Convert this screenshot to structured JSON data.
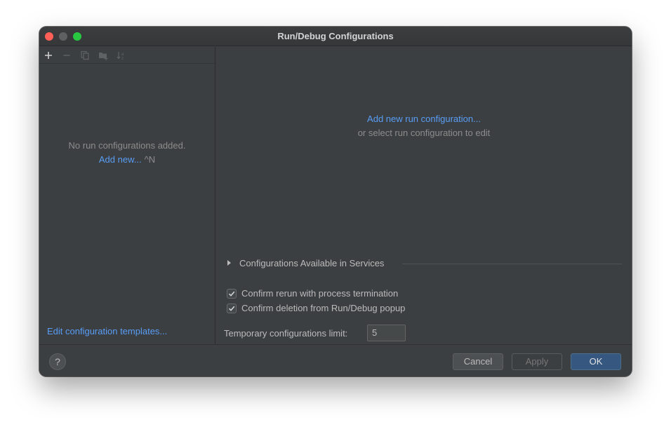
{
  "window": {
    "title": "Run/Debug Configurations",
    "traffic_colors": {
      "close": "#ff5f57",
      "minimize": "#5e6062",
      "maximize": "#28c840"
    }
  },
  "toolbar": {
    "icons": [
      "add-icon",
      "remove-icon",
      "copy-icon",
      "folder-icon",
      "sort-icon"
    ]
  },
  "left_panel": {
    "empty_message": "No run configurations added.",
    "add_new_link": "Add new...",
    "add_new_shortcut": "^N",
    "edit_templates_link": "Edit configuration templates..."
  },
  "right_panel": {
    "add_config_link": "Add new run configuration...",
    "select_hint": "or select run configuration to edit",
    "services_section": "Configurations Available in Services",
    "checkboxes": [
      {
        "label": "Confirm rerun with process termination",
        "checked": true
      },
      {
        "label": "Confirm deletion from Run/Debug popup",
        "checked": true
      }
    ],
    "temp_limit_label": "Temporary configurations limit:",
    "temp_limit_value": "5"
  },
  "footer": {
    "help_label": "?",
    "cancel_label": "Cancel",
    "apply_label": "Apply",
    "ok_label": "OK"
  },
  "colors": {
    "background": "#3c3f41",
    "link": "#589df6",
    "text": "#bbbbbb",
    "muted_text": "#8c8c8c",
    "primary_button": "#365880"
  }
}
